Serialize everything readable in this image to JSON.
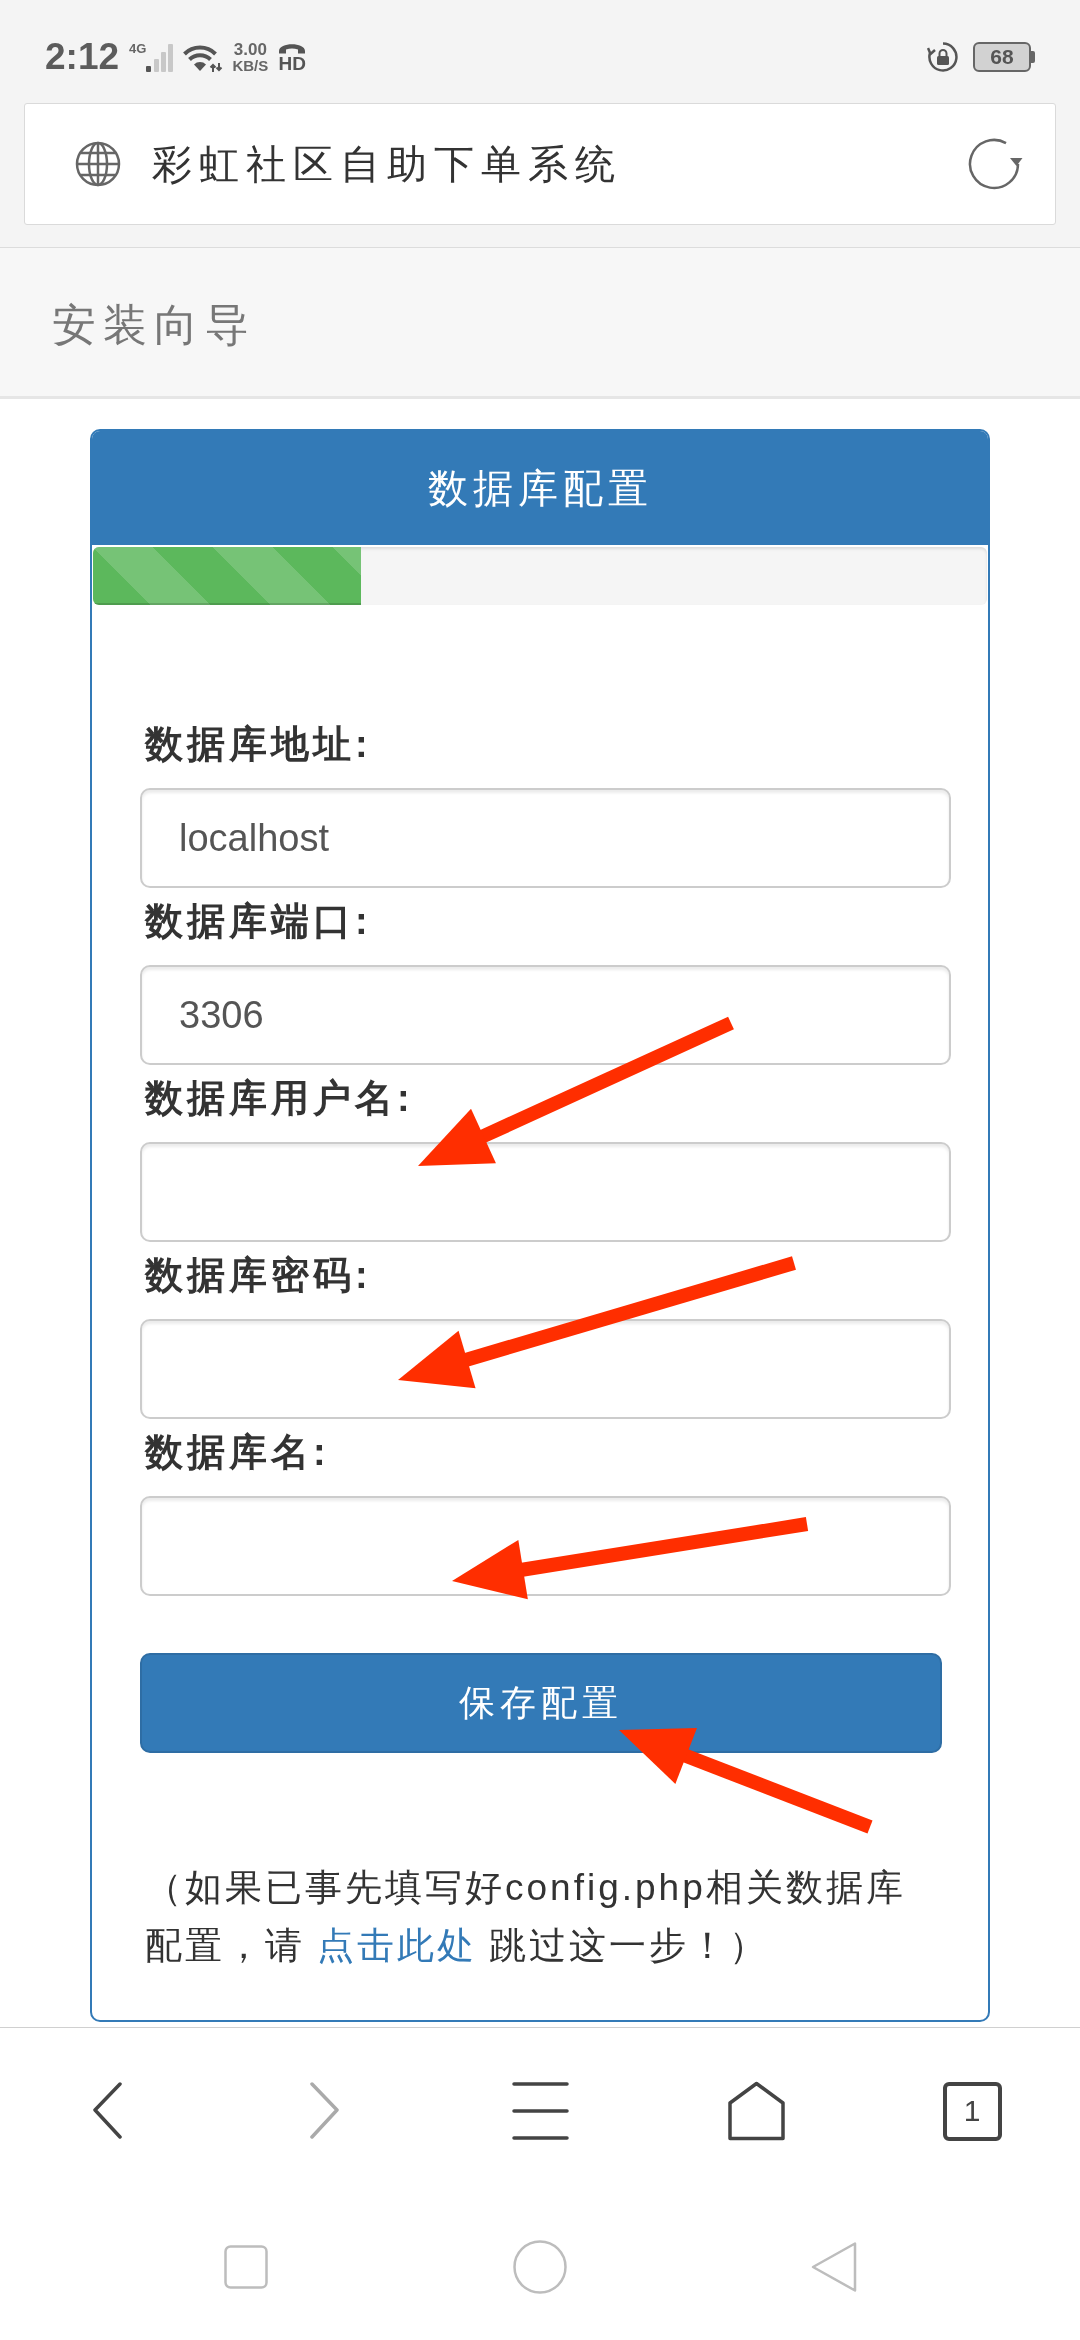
{
  "status_bar": {
    "time": "2:12",
    "network_type": "4G",
    "speed_value": "3.00",
    "speed_unit": "KB/S",
    "hd_label": "HD",
    "battery": "68"
  },
  "address_bar": {
    "title": "彩虹社区自助下单系统"
  },
  "page_header": {
    "title": "安装向导"
  },
  "panel": {
    "title": "数据库配置",
    "progress": {
      "level": 0.3
    },
    "fields": [
      {
        "label": "数据库地址:",
        "value": "localhost"
      },
      {
        "label": "数据库端口:",
        "value": "3306"
      },
      {
        "label": "数据库用户名:"
      },
      {
        "label": "数据库密码:"
      },
      {
        "label": "数据库名:"
      }
    ],
    "submit_button": "保存配置",
    "note": {
      "before": "（如果已事先填写好config.php相关数据库配置，请",
      "link": "点击此处",
      "after": "跳过这一步！）"
    }
  },
  "annotations": [
    {
      "kind": "arrow"
    },
    {
      "kind": "arrow"
    },
    {
      "kind": "arrow"
    },
    {
      "kind": "arrow"
    }
  ],
  "browser_nav": [
    {
      "kind": "back",
      "disabled": false
    },
    {
      "kind": "forward",
      "disabled": true
    },
    {
      "kind": "menu",
      "disabled": false
    },
    {
      "kind": "home",
      "disabled": false
    },
    {
      "kind": "tabs",
      "disabled": false,
      "count": "1"
    }
  ],
  "system_nav": [
    {
      "kind": "recents"
    },
    {
      "kind": "home"
    },
    {
      "kind": "back"
    }
  ]
}
